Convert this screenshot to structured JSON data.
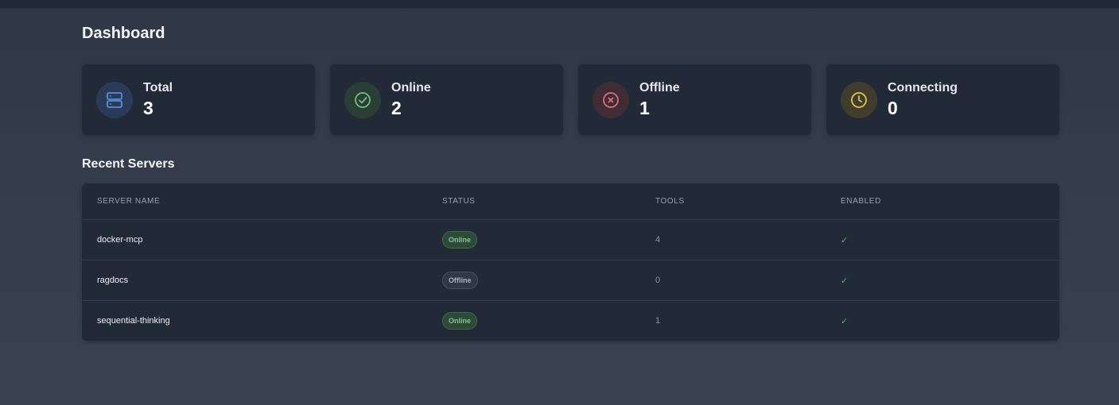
{
  "page": {
    "title": "Dashboard"
  },
  "stats": [
    {
      "label": "Total",
      "value": "3",
      "icon": "server-icon",
      "color": "#5b8fd9",
      "bg": "#2b3a56"
    },
    {
      "label": "Online",
      "value": "2",
      "icon": "check-circle-icon",
      "color": "#6fbf7f",
      "bg": "#2a3e36"
    },
    {
      "label": "Offline",
      "value": "1",
      "icon": "x-circle-icon",
      "color": "#d9707b",
      "bg": "#3f2c35"
    },
    {
      "label": "Connecting",
      "value": "0",
      "icon": "clock-icon",
      "color": "#e0c64a",
      "bg": "#403d2e"
    }
  ],
  "recent": {
    "title": "Recent Servers",
    "columns": [
      "SERVER NAME",
      "STATUS",
      "TOOLS",
      "ENABLED"
    ],
    "rows": [
      {
        "name": "docker-mcp",
        "status": "Online",
        "tools": "4",
        "enabled": "✓"
      },
      {
        "name": "ragdocs",
        "status": "Offline",
        "tools": "0",
        "enabled": "✓"
      },
      {
        "name": "sequential-thinking",
        "status": "Online",
        "tools": "1",
        "enabled": "✓"
      }
    ]
  }
}
